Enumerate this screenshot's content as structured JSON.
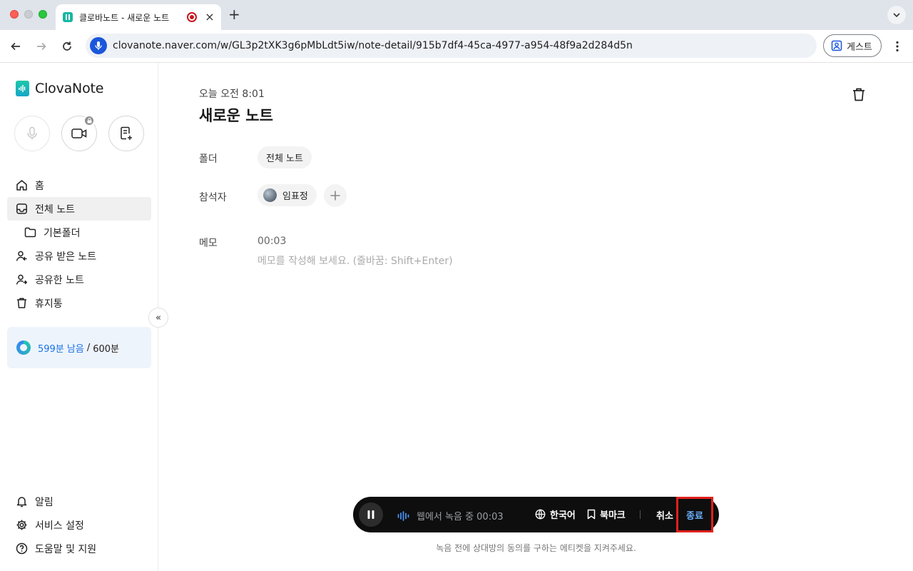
{
  "browser": {
    "tab_title": "클로바노트 - 새로운 노트",
    "tab_close": "×",
    "new_tab": "+",
    "url": "clovanote.naver.com/w/GL3p2tXK3g6pMbLdt5iw/note-detail/915b7df4-45ca-4977-a954-48f9a2d284d5n",
    "profile_label": "게스트"
  },
  "sidebar": {
    "logo_text": "ClovaNote",
    "nav_items": [
      {
        "label": "홈",
        "icon": "home-icon"
      },
      {
        "label": "전체 노트",
        "icon": "inbox-icon"
      },
      {
        "label": "기본폴더",
        "icon": "folder-icon"
      },
      {
        "label": "공유 받은 노트",
        "icon": "shared-in-icon"
      },
      {
        "label": "공유한 노트",
        "icon": "shared-out-icon"
      },
      {
        "label": "휴지통",
        "icon": "trash-icon"
      }
    ],
    "quota": {
      "remaining": "599분 남음",
      "separator": "/",
      "total": "600분"
    },
    "bottom_items": [
      {
        "label": "알림",
        "icon": "bell-icon"
      },
      {
        "label": "서비스 설정",
        "icon": "gear-icon"
      },
      {
        "label": "도움말 및 지원",
        "icon": "help-icon"
      }
    ],
    "collapse_glyph": "«"
  },
  "note": {
    "time": "오늘 오전 8:01",
    "title": "새로운 노트",
    "folder_label": "폴더",
    "folder_value": "전체 노트",
    "attendee_label": "참석자",
    "attendee_name": "임표정",
    "memo_label": "메모",
    "memo_time": "00:03",
    "memo_placeholder": "메모를 작성해 보세요. (줄바꿈: Shift+Enter)"
  },
  "recorder": {
    "status": "웹에서 녹음 중 00:03",
    "language": "한국어",
    "bookmark": "북마크",
    "cancel": "취소",
    "end": "종료",
    "consent_note": "녹음 전에 상대방의 동의를 구하는 에티켓을 지켜주세요."
  },
  "colors": {
    "accent_blue": "#1a73e8",
    "recording_bar": "#0e0e0e",
    "highlight_red": "#e0201c"
  }
}
